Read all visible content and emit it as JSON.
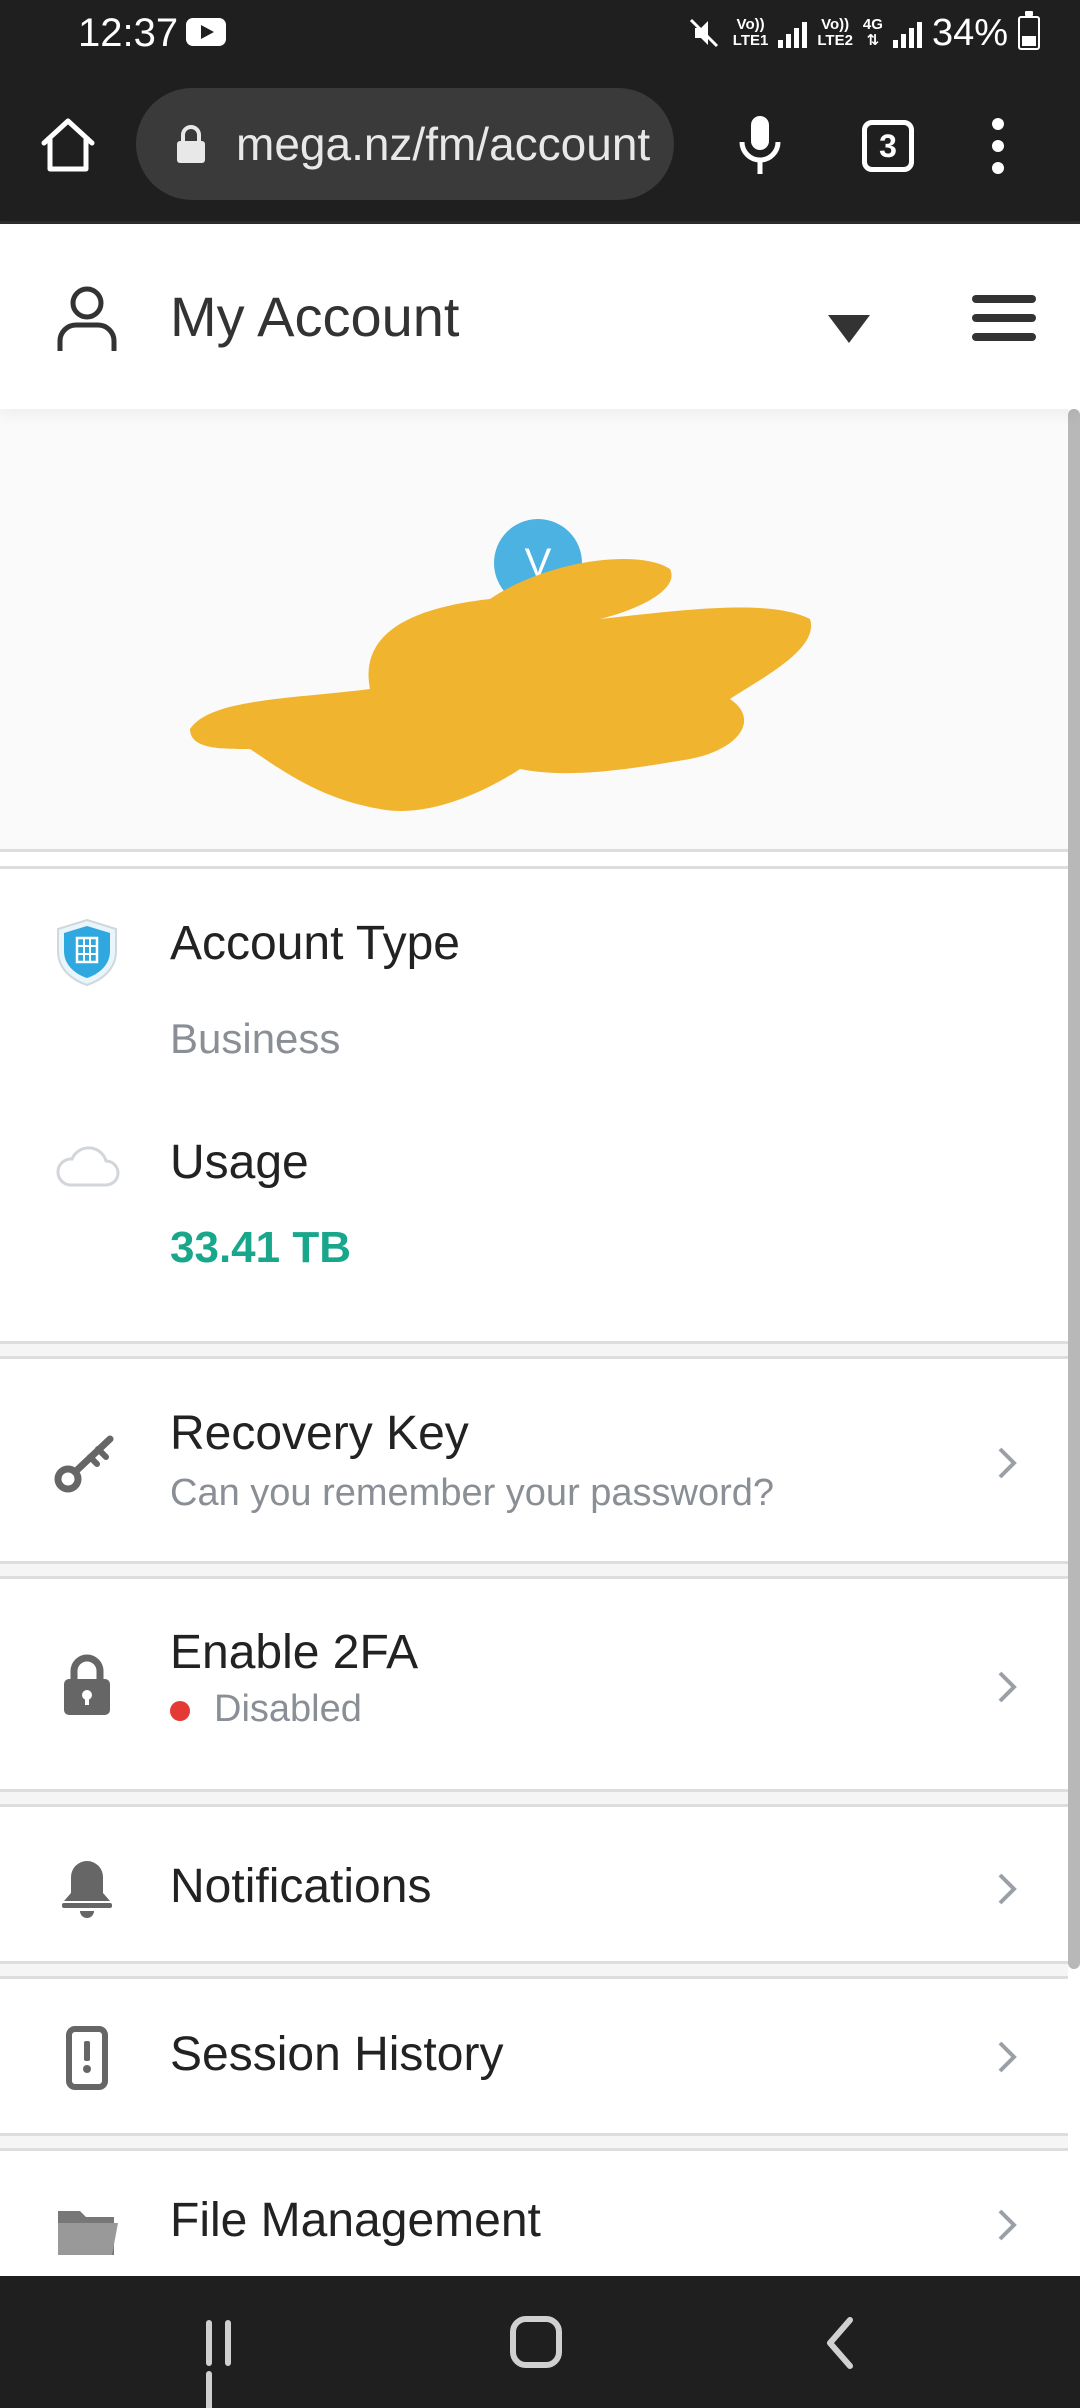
{
  "status_bar": {
    "time": "12:37",
    "net1_top": "Vo))",
    "net1_bottom": "LTE1",
    "net2_top": "Vo))",
    "net2_bottom": "LTE2",
    "net3_top": "4G",
    "net3_bottom": "⇅",
    "battery": "34%"
  },
  "browser": {
    "url": "mega.nz/fm/account",
    "tab_count": "3"
  },
  "header": {
    "title": "My Account"
  },
  "profile": {
    "avatar_initial": "V"
  },
  "account": {
    "type_label": "Account Type",
    "type_value": "Business",
    "usage_label": "Usage",
    "usage_value": "33.41 TB"
  },
  "menu": {
    "recovery_title": "Recovery Key",
    "recovery_subtitle": "Can you remember your password?",
    "twofa_title": "Enable 2FA",
    "twofa_status": "Disabled",
    "notifications": "Notifications",
    "session_history": "Session History",
    "file_management": "File Management"
  },
  "colors": {
    "accent_teal": "#19a78b",
    "shield_blue": "#2fa7df",
    "status_red": "#e53935",
    "redaction": "#f0b42f"
  },
  "icons": [
    "home-icon",
    "lock-icon",
    "mic-icon",
    "tabs-icon",
    "more-icon",
    "user-icon",
    "dropdown-icon",
    "hamburger-icon",
    "shield-icon",
    "cloud-icon",
    "key-icon",
    "padlock-icon",
    "bell-icon",
    "device-alert-icon",
    "folder-icon",
    "chevron-right-icon"
  ]
}
